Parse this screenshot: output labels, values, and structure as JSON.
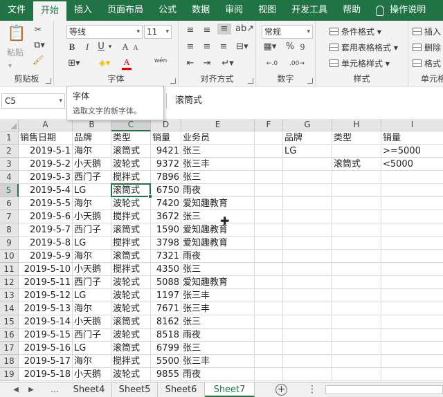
{
  "ribbon_tabs": [
    "文件",
    "开始",
    "插入",
    "页面布局",
    "公式",
    "数据",
    "审阅",
    "视图",
    "开发工具",
    "帮助",
    "操作说明"
  ],
  "active_tab_index": 1,
  "groups": {
    "clipboard": {
      "label": "剪贴板",
      "paste": "粘贴"
    },
    "font": {
      "label": "字体",
      "font_name": "等线",
      "font_size": "11",
      "grow": "A",
      "shrink": "A",
      "bold": "B",
      "italic": "I",
      "underline": "U",
      "color_letter": "A",
      "phonetic": "wén"
    },
    "alignment": {
      "label": "对齐方式"
    },
    "number": {
      "label": "数字",
      "format": "常规",
      "percent": "%",
      "comma": "9"
    },
    "styles": {
      "label": "样式",
      "cond_format": "条件格式 ▾",
      "table_format": "套用表格格式 ▾",
      "cell_style": "单元格样式 ▾"
    },
    "cells": {
      "label": "单元格",
      "insert": "插入",
      "delete": "删除",
      "format": "格式"
    }
  },
  "tooltip": {
    "title": "字体",
    "desc": "选取文字的新字体。"
  },
  "formula_bar": {
    "name_box": "C5",
    "content": "滚筒式"
  },
  "columns": [
    "A",
    "B",
    "C",
    "D",
    "E",
    "F",
    "G",
    "H",
    "I"
  ],
  "selected_column": "C",
  "selected_row": 5,
  "rows": [
    {
      "n": "1",
      "A": "销售日期",
      "B": "品牌",
      "C": "类型",
      "D": "销量",
      "E": "业务员",
      "G": "品牌",
      "H": "类型",
      "I": "销量"
    },
    {
      "n": "2",
      "A": "2019-5-1",
      "B": "海尔",
      "C": "滚筒式",
      "D": "9421",
      "E": "张三",
      "G": "LG",
      "H": "",
      "I": ">=5000"
    },
    {
      "n": "3",
      "A": "2019-5-2",
      "B": "小天鹅",
      "C": "波轮式",
      "D": "9372",
      "E": "张三丰",
      "G": "",
      "H": "滚筒式",
      "I": "<5000"
    },
    {
      "n": "4",
      "A": "2019-5-3",
      "B": "西门子",
      "C": "搅拌式",
      "D": "7896",
      "E": "张三"
    },
    {
      "n": "5",
      "A": "2019-5-4",
      "B": "LG",
      "C": "滚筒式",
      "D": "6750",
      "E": "雨夜"
    },
    {
      "n": "6",
      "A": "2019-5-5",
      "B": "海尔",
      "C": "波轮式",
      "D": "7420",
      "E": "爱知趣教育"
    },
    {
      "n": "7",
      "A": "2019-5-6",
      "B": "小天鹅",
      "C": "搅拌式",
      "D": "3672",
      "E": "张三"
    },
    {
      "n": "8",
      "A": "2019-5-7",
      "B": "西门子",
      "C": "滚筒式",
      "D": "1590",
      "E": "爱知趣教育"
    },
    {
      "n": "9",
      "A": "2019-5-8",
      "B": "LG",
      "C": "搅拌式",
      "D": "3798",
      "E": "爱知趣教育"
    },
    {
      "n": "10",
      "A": "2019-5-9",
      "B": "海尔",
      "C": "滚筒式",
      "D": "7321",
      "E": "雨夜"
    },
    {
      "n": "11",
      "A": "2019-5-10",
      "B": "小天鹅",
      "C": "搅拌式",
      "D": "4350",
      "E": "张三"
    },
    {
      "n": "12",
      "A": "2019-5-11",
      "B": "西门子",
      "C": "波轮式",
      "D": "5088",
      "E": "爱知趣教育"
    },
    {
      "n": "13",
      "A": "2019-5-12",
      "B": "LG",
      "C": "波轮式",
      "D": "1197",
      "E": "张三丰"
    },
    {
      "n": "14",
      "A": "2019-5-13",
      "B": "海尔",
      "C": "波轮式",
      "D": "7671",
      "E": "张三丰"
    },
    {
      "n": "15",
      "A": "2019-5-14",
      "B": "小天鹅",
      "C": "滚筒式",
      "D": "8162",
      "E": "张三"
    },
    {
      "n": "16",
      "A": "2019-5-15",
      "B": "西门子",
      "C": "波轮式",
      "D": "8518",
      "E": "雨夜"
    },
    {
      "n": "17",
      "A": "2019-5-16",
      "B": "LG",
      "C": "滚筒式",
      "D": "6799",
      "E": "张三"
    },
    {
      "n": "18",
      "A": "2019-5-17",
      "B": "海尔",
      "C": "搅拌式",
      "D": "5500",
      "E": "张三丰"
    },
    {
      "n": "19",
      "A": "2019-5-18",
      "B": "小天鹅",
      "C": "波轮式",
      "D": "9855",
      "E": "雨夜"
    }
  ],
  "sheet_tabs": [
    "Sheet4",
    "Sheet5",
    "Sheet6",
    "Sheet7"
  ],
  "active_sheet": "Sheet7",
  "colors": {
    "accent": "#217346"
  }
}
